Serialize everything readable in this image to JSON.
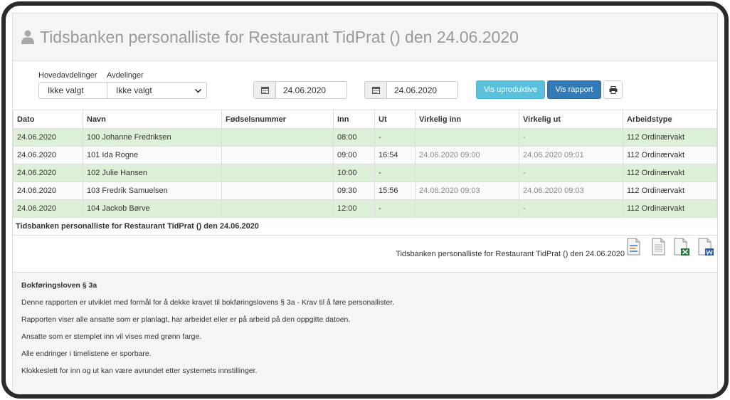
{
  "header": {
    "title": "Tidsbanken personalliste for Restaurant TidPrat () den 24.06.2020"
  },
  "filters": {
    "hovedavdelinger_label": "Hovedavdelinger",
    "hovedavdelinger_value": "Ikke valgt",
    "avdelinger_label": "Avdelinger",
    "avdelinger_value": "Ikke valgt",
    "date_from": "24.06.2020",
    "date_to": "24.06.2020",
    "btn_uproduktive": "Vis uproduktive",
    "btn_rapport": "Vis rapport"
  },
  "table": {
    "columns": [
      "Dato",
      "Navn",
      "Fødselsnummer",
      "Inn",
      "Ut",
      "Virkelig inn",
      "Virkelig ut",
      "Arbeidstype"
    ],
    "rows": [
      {
        "dato": "24.06.2020",
        "navn": "100 Johanne Fredriksen",
        "fnr": "",
        "inn": "08:00",
        "ut": "-",
        "vinn": "",
        "vut": "-",
        "type": "112 Ordinærvakt",
        "stamped": true
      },
      {
        "dato": "24.06.2020",
        "navn": "101 Ida Rogne",
        "fnr": "",
        "inn": "09:00",
        "ut": "16:54",
        "vinn": "24.06.2020 09:00",
        "vut": "24.06.2020 09:01",
        "type": "112 Ordinærvakt",
        "stamped": false
      },
      {
        "dato": "24.06.2020",
        "navn": "102 Julie Hansen",
        "fnr": "",
        "inn": "10:00",
        "ut": "-",
        "vinn": "",
        "vut": "-",
        "type": "112 Ordinærvakt",
        "stamped": true
      },
      {
        "dato": "24.06.2020",
        "navn": "103 Fredrik Samuelsen",
        "fnr": "",
        "inn": "09:30",
        "ut": "15:56",
        "vinn": "24.06.2020 09:03",
        "vut": "24.06.2020 09:03",
        "type": "112 Ordinærvakt",
        "stamped": false
      },
      {
        "dato": "24.06.2020",
        "navn": "104 Jackob Børve",
        "fnr": "",
        "inn": "12:00",
        "ut": "-",
        "vinn": "",
        "vut": "-",
        "type": "112 Ordinærvakt",
        "stamped": true
      }
    ],
    "footer": "Tidsbanken personalliste for Restaurant TidPrat () den 24.06.2020"
  },
  "export": {
    "title": "Tidsbanken personalliste for Restaurant TidPrat () den 24.06.2020"
  },
  "info": {
    "title": "Bokføringsloven § 3a",
    "lines": [
      "Denne rapporten er utviklet med formål for å dekke kravet til bokføringslovens § 3a - Krav til å føre personallister.",
      "Rapporten viser alle ansatte som er planlagt, har arbeidet eller er på arbeid på den oppgitte datoen.",
      "Ansatte som er stemplet inn vil vises med grønn farge.",
      "Alle endringer i timelistene er sporbare.",
      "Klokkeslett for inn og ut kan være avrundet etter systemets innstillinger."
    ]
  },
  "colors": {
    "stamped_row": "#dff0d8",
    "btn_info": "#5bc0de",
    "btn_primary": "#337ab7"
  },
  "icons": [
    "user-icon",
    "calendar-icon",
    "print-icon",
    "export-pdf-icon",
    "export-csv-icon",
    "export-excel-icon",
    "export-word-icon",
    "chevron-down-icon"
  ]
}
